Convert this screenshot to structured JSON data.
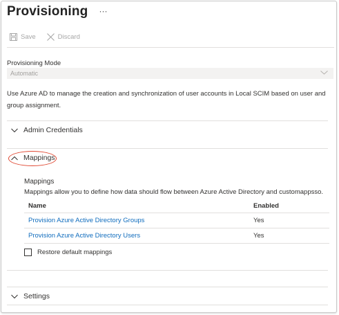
{
  "header": {
    "title": "Provisioning",
    "more": "···"
  },
  "toolbar": {
    "save_label": "Save",
    "discard_label": "Discard"
  },
  "mode": {
    "label": "Provisioning Mode",
    "value": "Automatic"
  },
  "description": "Use Azure AD to manage the creation and synchronization of user accounts in Local SCIM based on user and group assignment.",
  "sections": {
    "admin": "Admin Credentials",
    "mappings": "Mappings",
    "settings": "Settings"
  },
  "mappings_panel": {
    "title": "Mappings",
    "description": "Mappings allow you to define how data should flow between Azure Active Directory and customappsso.",
    "columns": {
      "name": "Name",
      "enabled": "Enabled"
    },
    "rows": [
      {
        "name": "Provision Azure Active Directory Groups",
        "enabled": "Yes"
      },
      {
        "name": "Provision Azure Active Directory Users",
        "enabled": "Yes"
      }
    ],
    "restore_label": "Restore default mappings"
  }
}
